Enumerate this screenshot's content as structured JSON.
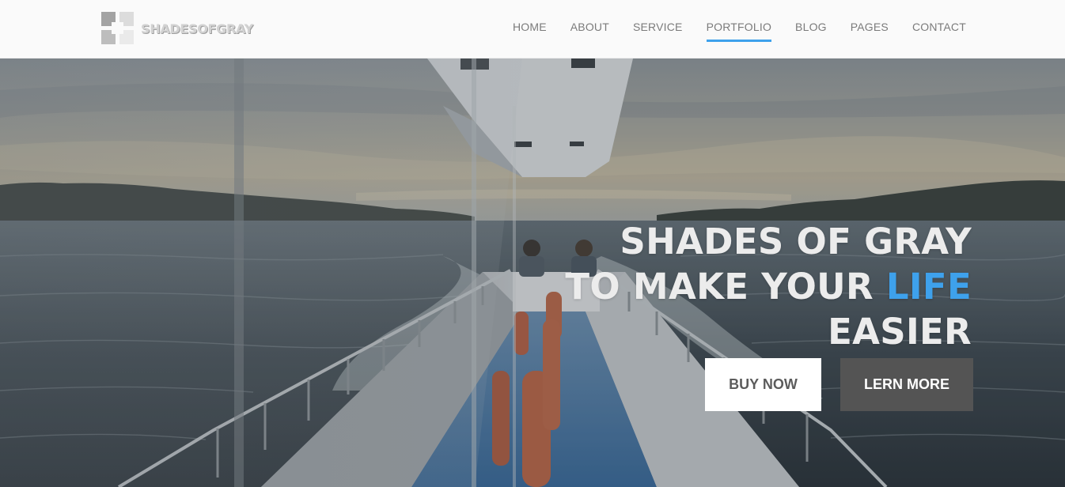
{
  "brand": {
    "logo_text": "SHADESOFGRAY",
    "logo_icon": "four-squares-logo-icon"
  },
  "nav": {
    "items": [
      {
        "label": "HOME"
      },
      {
        "label": "ABOUT"
      },
      {
        "label": "SERVICE"
      },
      {
        "label": "PORTFOLIO"
      },
      {
        "label": "BLOG"
      },
      {
        "label": "PAGES"
      },
      {
        "label": "CONTACT"
      }
    ],
    "active_label": "PORTFOLIO",
    "active_underline_color": "#3ea1ec"
  },
  "hero": {
    "background": "photo-boat-deck-sea-islands",
    "line1": "SHADES OF GRAY",
    "line2_prefix": "TO MAKE YOUR",
    "line2_highlight": "LIFE",
    "line3": "EASIER",
    "highlight_color": "#3ea1ec",
    "primary_button": "BUY NOW",
    "secondary_button": "LERN MORE"
  }
}
